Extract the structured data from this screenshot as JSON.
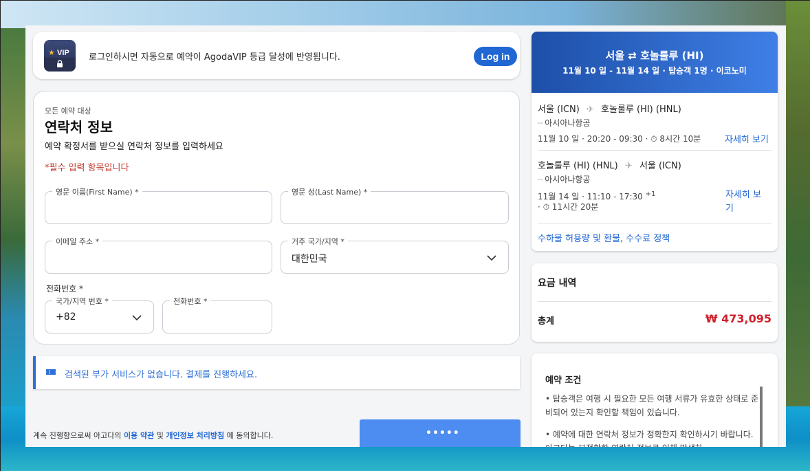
{
  "login_banner": {
    "vip_text": "VIP",
    "message": "로그인하시면 자동으로 예약이 AgodaVIP 등급 달성에 반영됩니다.",
    "login_button": "Log in"
  },
  "contact": {
    "eyebrow": "모든 예약 대상",
    "title": "연락처 정보",
    "description": "예약 확정서를 받으실 연락처 정보를 입력하세요",
    "required_note": "*필수 입력 항목입니다",
    "first_name_label": "영문 이름(First Name) *",
    "first_name_value": "",
    "last_name_label": "영문 성(Last Name) *",
    "last_name_value": "",
    "email_label": "이메일 주소 *",
    "email_value": "",
    "country_label": "거주 국가/지역 *",
    "country_value": "대한민국",
    "phone_section_label": "전화번호 *",
    "country_code_label": "국가/지역 번호 *",
    "country_code_value": "+82",
    "phone_label": "전화번호 *",
    "phone_value": ""
  },
  "addon": {
    "message": "검색된 부가 서비스가 없습니다. 결제를 진행하세요."
  },
  "footer": {
    "terms_prefix": "계속 진행함으로써 아고다의",
    "terms_link": "이용 약관",
    "terms_and": "및",
    "privacy_link": "개인정보 처리방침",
    "terms_suffix": "에 동의합니다.",
    "pay_button_loading": "•••••"
  },
  "flight": {
    "route": "서울 ⇄ 호놀룰루 (HI)",
    "meta": "11월 10 일 - 11월 14 일 · 탑승객 1명 · 이코노미",
    "legs": [
      {
        "from": "서울 (ICN)",
        "to": "호놀룰루 (HI) (HNL)",
        "airline": "아시아나항공",
        "time_line1": "11월 10 일 · 20:20 - 09:30 · ⏱ 8시간 10분",
        "time_line2": "",
        "details_link": "자세히 보기"
      },
      {
        "from": "호놀룰루 (HI) (HNL)",
        "to": "서울 (ICN)",
        "airline": "아시아나항공",
        "time_line1": "11월 14 일 · 11:10 - 17:30",
        "plus_day": "+1",
        "time_line2": "· ⏱ 11시간 20분",
        "details_link_1": "자세히 보",
        "details_link_2": "기"
      }
    ],
    "baggage_link": "수하물 허용량 및 환불, 수수료 정책"
  },
  "price": {
    "title": "요금 내역",
    "total_label": "총계",
    "total_value": "₩ 473,095"
  },
  "conditions": {
    "title": "예약 조건",
    "item1": "• 탑승객은 여행 시 필요한 모든 여행 서류가 유효한 상태로 준비되어 있는지 확인할 책임이 있습니다.",
    "item2": "• 예약에 대한 연락처 정보가 정확한지 확인하시기 바랍니다. 아고다는 부정확한 연락처 정보로 인해 발생하"
  },
  "colors": {
    "primary": "#2067d4",
    "price_red": "#d0202a",
    "required_red": "#c0392b",
    "header_gradient_start": "#1d4fa8",
    "header_gradient_end": "#3f7fe6"
  }
}
